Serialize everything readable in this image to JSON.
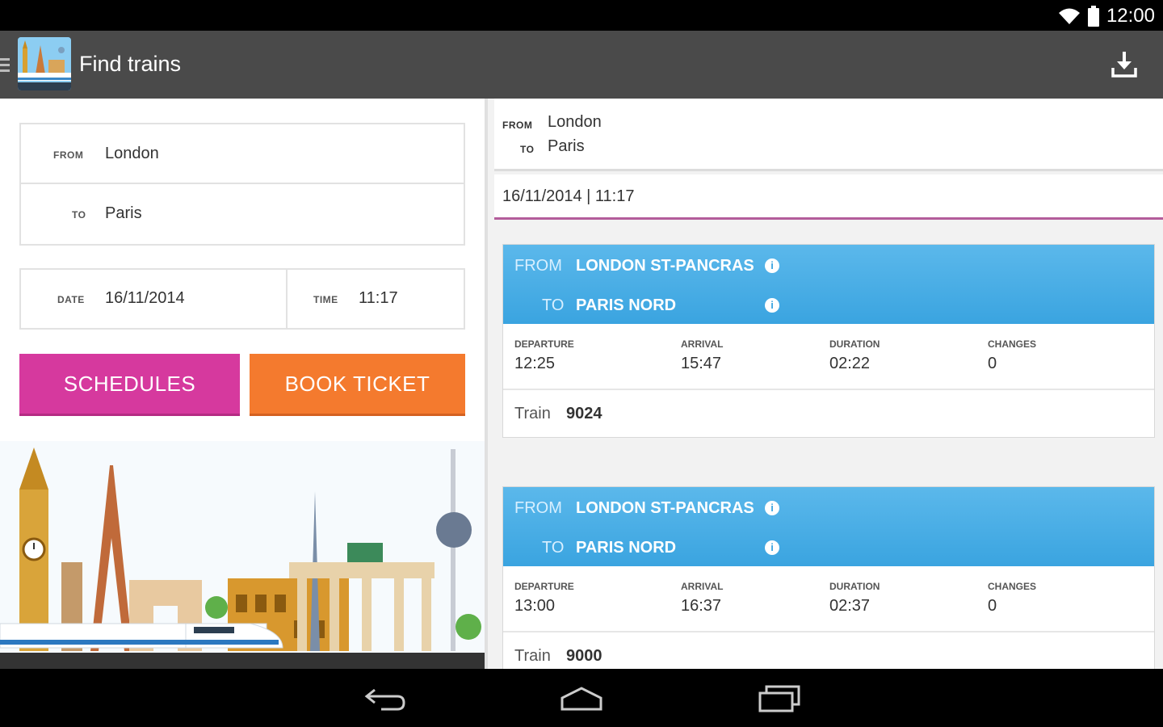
{
  "status": {
    "time": "12:00",
    "icons": [
      "wifi-icon",
      "battery-icon"
    ]
  },
  "appbar": {
    "title": "Find trains",
    "icons": [
      "menu-icon",
      "app-logo-icon",
      "download-icon"
    ]
  },
  "form": {
    "from_label": "FROM",
    "from_value": "London",
    "to_label": "TO",
    "to_value": "Paris",
    "date_label": "DATE",
    "date_value": "16/11/2014",
    "time_label": "TIME",
    "time_value": "11:17"
  },
  "buttons": {
    "schedules": "SCHEDULES",
    "book_ticket": "BOOK TICKET"
  },
  "results": {
    "from_label": "FROM",
    "from_value": "London",
    "to_label": "TO",
    "to_value": "Paris",
    "datetime": "16/11/2014  |  11:17",
    "journeys": [
      {
        "from_label": "FROM",
        "from_station": "LONDON ST-PANCRAS",
        "to_label": "TO",
        "to_station": "PARIS NORD",
        "departure_label": "DEPARTURE",
        "departure": "12:25",
        "arrival_label": "ARRIVAL",
        "arrival": "15:47",
        "duration_label": "DURATION",
        "duration": "02:22",
        "changes_label": "CHANGES",
        "changes": "0",
        "train_label": "Train",
        "train_number": "9024"
      },
      {
        "from_label": "FROM",
        "from_station": "LONDON ST-PANCRAS",
        "to_label": "TO",
        "to_station": "PARIS NORD",
        "departure_label": "DEPARTURE",
        "departure": "13:00",
        "arrival_label": "ARRIVAL",
        "arrival": "16:37",
        "duration_label": "DURATION",
        "duration": "02:37",
        "changes_label": "CHANGES",
        "changes": "0",
        "train_label": "Train",
        "train_number": "9000"
      }
    ]
  },
  "colors": {
    "accent_magenta": "#d6399e",
    "accent_orange": "#f47a2e",
    "card_blue": "#3aa4e0",
    "appbar": "#4a4a4a"
  },
  "nav": {
    "icons": [
      "back-icon",
      "home-icon",
      "recents-icon"
    ]
  }
}
